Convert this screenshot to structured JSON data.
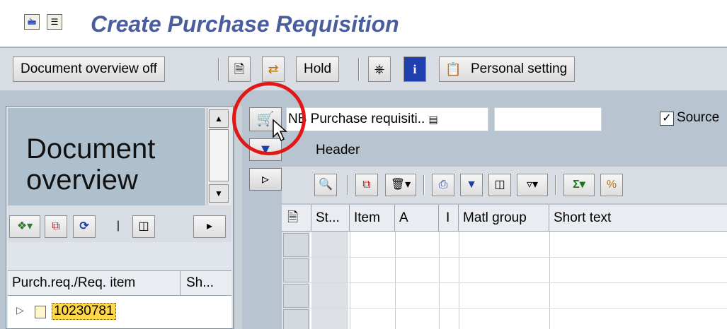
{
  "title": "Create Purchase Requisition",
  "titlebar": {
    "icons": [
      "exit-editing-icon",
      "menu-icon"
    ]
  },
  "toolbar": {
    "document_overview_label": "Document overview off",
    "hold_label": "Hold",
    "personal_setting_label": "Personal setting",
    "icons": [
      "create-icon",
      "other-document-icon",
      "tree-icon",
      "info-icon",
      "personal-setting-icon"
    ]
  },
  "left_panel": {
    "overview_title": "Document overview",
    "toolbar_icons": [
      "selection-variant-icon",
      "copy-icon",
      "refresh-icon",
      "find-icon",
      "expand-icon"
    ],
    "columns": [
      "Purch.req./Req. item",
      "Sh..."
    ],
    "rows": [
      {
        "number": "10230781"
      }
    ]
  },
  "right_panel": {
    "doc_type_label": "NB Purchase requisiti..",
    "source_label": "Source",
    "source_checked": true,
    "header_label": "Header",
    "toolbar_icons": [
      "detail-icon",
      "copy-icon",
      "delete-icon",
      "print-icon",
      "filter-icon",
      "find-icon",
      "filter-set-icon",
      "sum-icon",
      "subtotal-icon"
    ],
    "columns": [
      "St...",
      "Item",
      "A",
      "I",
      "Matl group",
      "Short text"
    ]
  },
  "colors": {
    "title": "#4a5d9c",
    "work_area": "#b8c4cf",
    "highlight": "#ffd84a",
    "annotation": "#e01818"
  }
}
